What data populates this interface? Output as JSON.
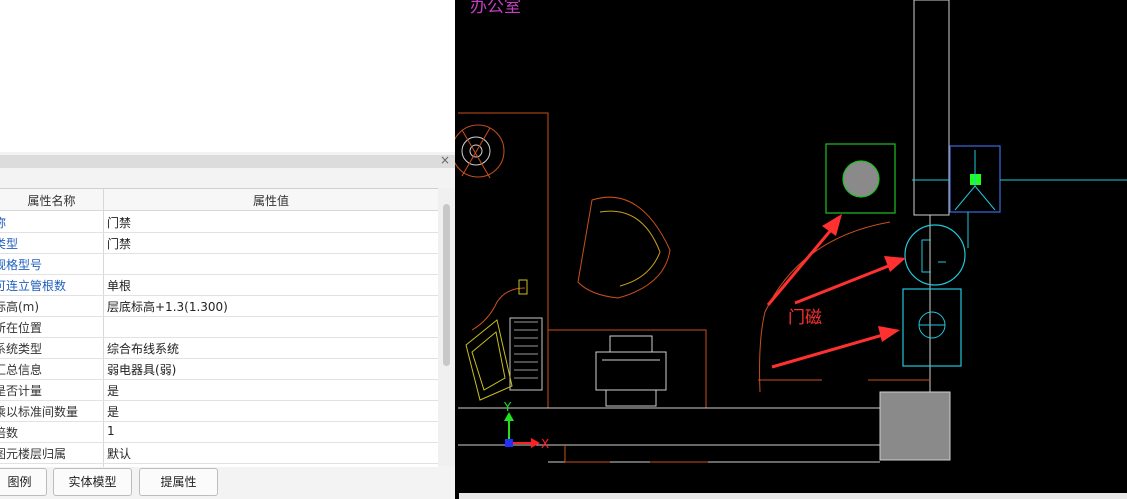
{
  "properties_panel": {
    "close_glyph": "×",
    "header": {
      "name": "属性名称",
      "value": "属性值"
    },
    "rows": [
      {
        "name": "称",
        "value": "门禁",
        "link": true
      },
      {
        "name": "类型",
        "value": "门禁",
        "link": true
      },
      {
        "name": "规格型号",
        "value": "",
        "link": true
      },
      {
        "name": "可连立管根数",
        "value": "单根",
        "link": true
      },
      {
        "name": "标高(m)",
        "value": "层底标高+1.3(1.300)",
        "link": false
      },
      {
        "name": "所在位置",
        "value": "",
        "link": false
      },
      {
        "name": "系统类型",
        "value": "综合布线系统",
        "link": false
      },
      {
        "name": "汇总信息",
        "value": "弱电器具(弱)",
        "link": false
      },
      {
        "name": "是否计量",
        "value": "是",
        "link": false
      },
      {
        "name": "乘以标准间数量",
        "value": "是",
        "link": false
      },
      {
        "name": "倍数",
        "value": "1",
        "link": false
      },
      {
        "name": "图元楼层归属",
        "value": "默认",
        "link": false
      }
    ],
    "buttons": {
      "legend": "图例",
      "solid_model": "实体模型",
      "extract": "提属性"
    }
  },
  "cad": {
    "top_text": "办公室",
    "annotation": "门磁",
    "axis_x": "X",
    "axis_y": "Y",
    "colors": {
      "background": "#000000",
      "annotation": "#ff3030",
      "wall": "#d0d0d0",
      "furniture": "#c8501e",
      "device_green": "#20c020",
      "device_cyan": "#20c8d8"
    }
  }
}
